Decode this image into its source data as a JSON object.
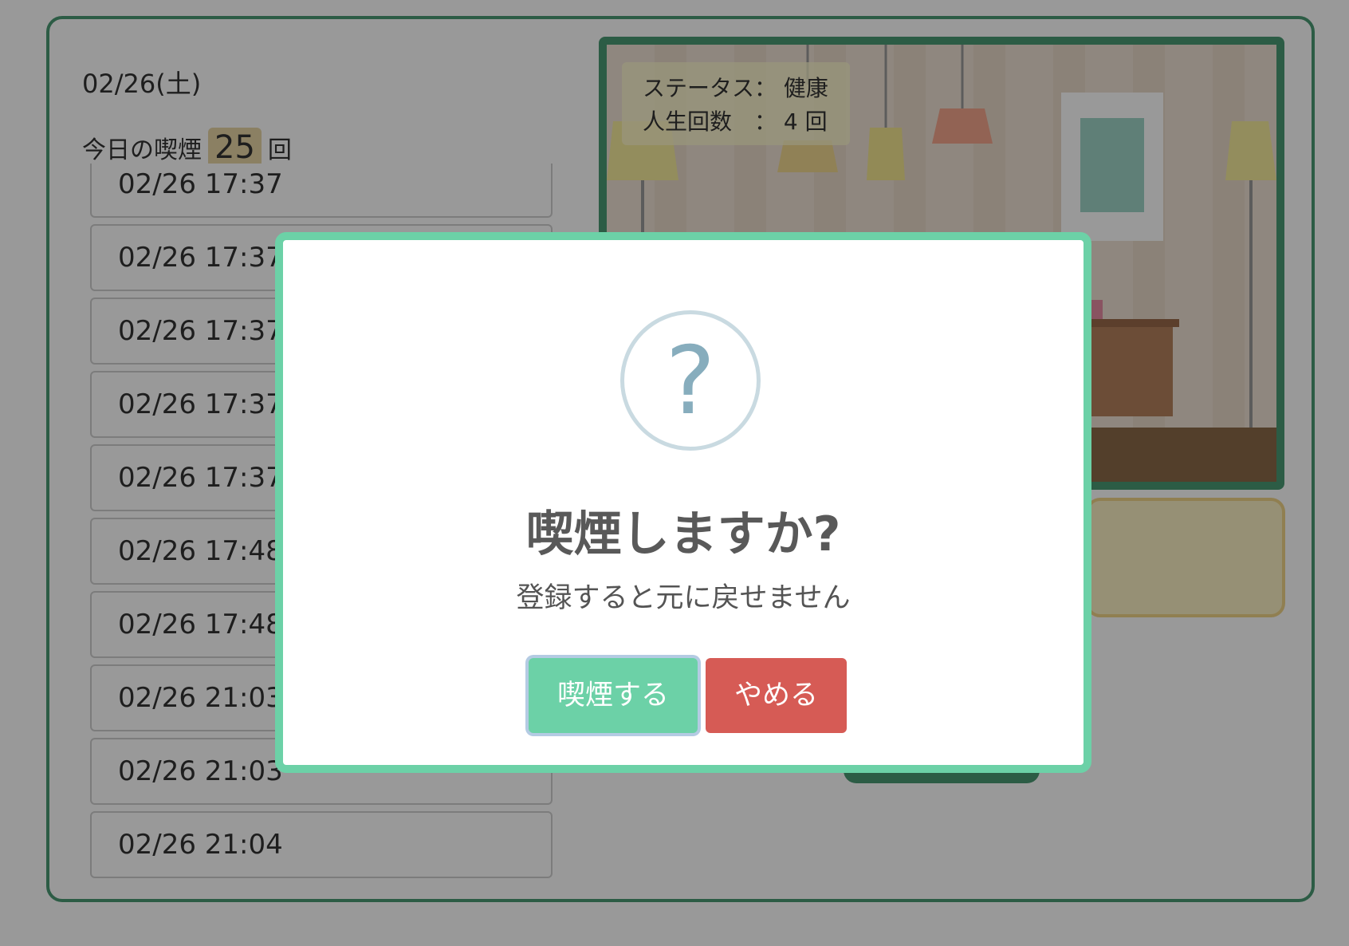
{
  "date": "02/26(土)",
  "today": {
    "prefix": "今日の喫煙",
    "count": "25",
    "suffix": "回"
  },
  "records": [
    "02/26 17:37",
    "02/26 17:37",
    "02/26 17:37",
    "02/26 17:37",
    "02/26 17:37",
    "02/26 17:48",
    "02/26 17:48",
    "02/26 21:03",
    "02/26 21:03",
    "02/26 21:04"
  ],
  "status": {
    "line1": "ステータス： 健康",
    "line2": "人生回数　： 4 回"
  },
  "modal": {
    "icon": "question-icon",
    "icon_glyph": "?",
    "title": "喫煙しますか?",
    "text": "登録すると元に戻せません",
    "confirm_label": "喫煙する",
    "cancel_label": "やめる"
  },
  "colors": {
    "accent_green": "#4a9a73",
    "modal_border": "#6cd1a7",
    "cancel_red": "#d65b55"
  }
}
